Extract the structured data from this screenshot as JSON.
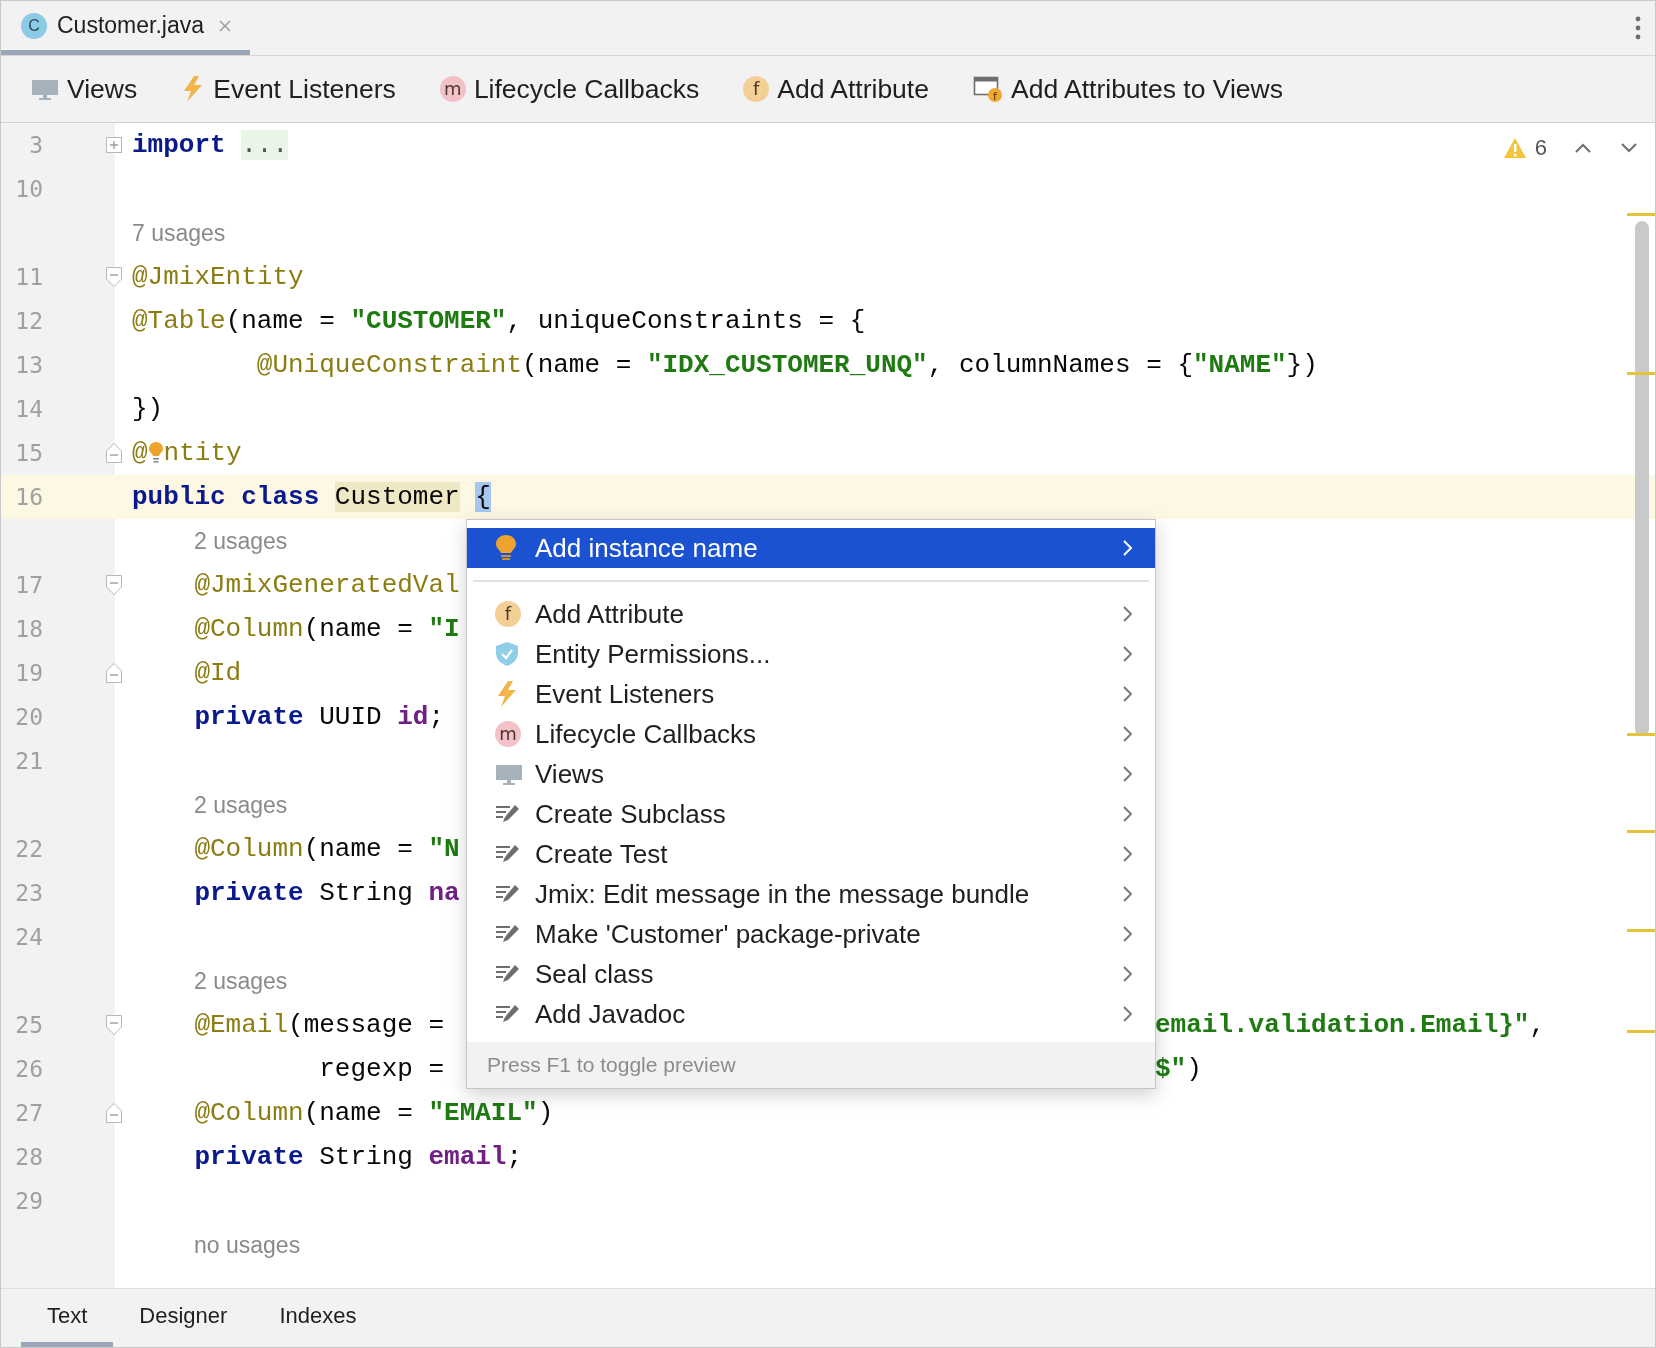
{
  "tabs": [
    {
      "label": "Customer.java",
      "badge": "C",
      "color": "#8ccbe6",
      "selected": true
    }
  ],
  "toolbar": {
    "items": [
      {
        "label": "Views",
        "kind": "monitor"
      },
      {
        "label": "Event Listeners",
        "kind": "bolt"
      },
      {
        "label": "Lifecycle Callbacks",
        "kind": "badge",
        "badge": "m",
        "color": "#f3c1c8"
      },
      {
        "label": "Add Attribute",
        "kind": "badge",
        "badge": "f",
        "color": "#f3cf96"
      },
      {
        "label": "Add Attributes to Views",
        "kind": "window",
        "badge": "f",
        "color": "#f0a732"
      }
    ]
  },
  "inspections": {
    "count": "6"
  },
  "editor": {
    "rows": [
      {
        "kind": "code",
        "number": "3",
        "collapsed": true,
        "current": false,
        "tokens": [
          {
            "kind": "kw",
            "text": "import"
          },
          {
            "kind": "folded",
            "text": "...",
            "space_before": true
          }
        ]
      },
      {
        "kind": "code",
        "number": "10",
        "current": false,
        "tokens": []
      },
      {
        "kind": "hint",
        "text": "7 usages"
      },
      {
        "kind": "code",
        "number": "11",
        "fold_start": true,
        "current": false,
        "tokens": [
          {
            "kind": "ann",
            "text": "@JmixEntity"
          }
        ]
      },
      {
        "kind": "code",
        "number": "12",
        "current": false,
        "tokens": [
          {
            "kind": "ann",
            "text": "@Table"
          },
          {
            "kind": "plain",
            "text": "(name ="
          },
          {
            "kind": "str",
            "text": "\"CUSTOMER\"",
            "space_before": true
          },
          {
            "kind": "plain",
            "text": ", uniqueConstraints = {"
          }
        ]
      },
      {
        "kind": "continuation",
        "number": "13",
        "current": false,
        "tokens": [
          {
            "kind": "ann",
            "text": "@UniqueConstraint"
          },
          {
            "kind": "plain",
            "text": "(name ="
          },
          {
            "kind": "str",
            "text": "\"IDX_CUSTOMER_UNQ\"",
            "space_before": true
          },
          {
            "kind": "plain",
            "text": ", columnNames = {"
          },
          {
            "kind": "str",
            "text": "\"NAME\""
          },
          {
            "kind": "plain",
            "text": "})"
          }
        ]
      },
      {
        "kind": "code",
        "number": "14",
        "current": false,
        "tokens": [
          {
            "kind": "plain",
            "text": "})"
          }
        ]
      },
      {
        "kind": "code",
        "number": "15",
        "fold_end": true,
        "current": false,
        "bulb": true,
        "tokens": [
          {
            "kind": "ann",
            "text": "@"
          },
          {
            "kind": "ann",
            "text": "ntity"
          }
        ]
      },
      {
        "kind": "code",
        "number": "16",
        "current": true,
        "tokens": [
          {
            "kind": "kw",
            "text": "public"
          },
          {
            "kind": "kw",
            "text": "class",
            "space_before": true
          },
          {
            "kind": "usage",
            "text": "Customer",
            "space_before": true
          },
          {
            "kind": "brace",
            "text": "{",
            "space_before": true
          }
        ]
      },
      {
        "kind": "member_hint",
        "text": "2 usages"
      },
      {
        "kind": "member",
        "number": "17",
        "fold_start": true,
        "current": false,
        "tokens": [
          {
            "kind": "ann",
            "text": "@JmixGeneratedVal"
          }
        ]
      },
      {
        "kind": "member",
        "number": "18",
        "current": false,
        "tokens": [
          {
            "kind": "ann",
            "text": "@Column"
          },
          {
            "kind": "plain",
            "text": "(name ="
          },
          {
            "kind": "str",
            "text": "\"I",
            "space_before": true
          }
        ]
      },
      {
        "kind": "member",
        "number": "19",
        "fold_end": true,
        "current": false,
        "tokens": [
          {
            "kind": "ann",
            "text": "@Id"
          }
        ]
      },
      {
        "kind": "member",
        "number": "20",
        "current": false,
        "tokens": [
          {
            "kind": "kw",
            "text": "private"
          },
          {
            "kind": "plain",
            "text": "UUID",
            "space_before": true
          },
          {
            "kind": "field",
            "text": "id",
            "space_before": true
          },
          {
            "kind": "plain",
            "text": ";"
          }
        ]
      },
      {
        "kind": "code",
        "number": "21",
        "current": false,
        "tokens": []
      },
      {
        "kind": "member_hint",
        "text": "2 usages"
      },
      {
        "kind": "member",
        "number": "22",
        "current": false,
        "tokens": [
          {
            "kind": "ann",
            "text": "@Column"
          },
          {
            "kind": "plain",
            "text": "(name ="
          },
          {
            "kind": "str",
            "text": "\"N",
            "space_before": true
          }
        ]
      },
      {
        "kind": "member",
        "number": "23",
        "current": false,
        "tokens": [
          {
            "kind": "kw",
            "text": "private"
          },
          {
            "kind": "plain",
            "text": "String",
            "space_before": true
          },
          {
            "kind": "field",
            "text": "na",
            "space_before": true
          }
        ]
      },
      {
        "kind": "code",
        "number": "24",
        "current": false,
        "tokens": []
      },
      {
        "kind": "member_hint",
        "text": "2 usages"
      },
      {
        "kind": "member",
        "number": "25",
        "fold_start": true,
        "current": false,
        "tokens": [
          {
            "kind": "ann",
            "text": "@Email"
          },
          {
            "kind": "plain",
            "text": "(message ="
          }
        ],
        "tail": [
          {
            "kind": "str",
            "text": "email.validation.Email}\""
          },
          {
            "kind": "plain",
            "text": ","
          }
        ]
      },
      {
        "kind": "argument",
        "number": "26",
        "current": false,
        "tokens": [
          {
            "kind": "plain",
            "text": "regexp ="
          }
        ],
        "tail": [
          {
            "kind": "str",
            "text": "$\""
          },
          {
            "kind": "plain",
            "text": ")"
          }
        ]
      },
      {
        "kind": "member",
        "number": "27",
        "fold_end": true,
        "current": false,
        "tokens": [
          {
            "kind": "ann",
            "text": "@Column"
          },
          {
            "kind": "plain",
            "text": "(name ="
          },
          {
            "kind": "str",
            "text": "\"EMAIL\"",
            "space_before": true
          },
          {
            "kind": "plain",
            "text": ")"
          }
        ]
      },
      {
        "kind": "member",
        "number": "28",
        "current": false,
        "tokens": [
          {
            "kind": "kw",
            "text": "private"
          },
          {
            "kind": "plain",
            "text": "String",
            "space_before": true
          },
          {
            "kind": "field",
            "text": "email",
            "space_before": true
          },
          {
            "kind": "plain",
            "text": ";"
          }
        ]
      },
      {
        "kind": "code",
        "number": "29",
        "current": false,
        "tokens": []
      },
      {
        "kind": "member_hint",
        "text": "no usages"
      }
    ]
  },
  "popup": {
    "groups": [
      {
        "items": [
          {
            "label": "Add instance name",
            "kind": "bulb",
            "selected": true
          }
        ]
      },
      {
        "items": [
          {
            "label": "Add Attribute",
            "kind": "badge",
            "badge": "f",
            "color": "#f3cf96",
            "selected": false
          },
          {
            "label": "Entity Permissions...",
            "kind": "shield",
            "selected": false
          },
          {
            "label": "Event Listeners",
            "kind": "bolt",
            "selected": false
          },
          {
            "label": "Lifecycle Callbacks",
            "kind": "badge",
            "badge": "m",
            "color": "#f3c1c8",
            "selected": false
          },
          {
            "label": "Views",
            "kind": "monitor",
            "selected": false
          },
          {
            "label": "Create Subclass",
            "kind": "edit",
            "selected": false
          },
          {
            "label": "Create Test",
            "kind": "edit",
            "selected": false
          },
          {
            "label": "Jmix: Edit message in the message bundle",
            "kind": "edit",
            "selected": false
          },
          {
            "label": "Make 'Customer' package-private",
            "kind": "edit",
            "selected": false
          },
          {
            "label": "Seal class",
            "kind": "edit",
            "selected": false
          },
          {
            "label": "Add Javadoc",
            "kind": "edit",
            "selected": false
          }
        ]
      }
    ],
    "footer": "Press F1 to toggle preview"
  },
  "bottom_tabs": [
    {
      "label": "Text",
      "selected": true
    },
    {
      "label": "Designer",
      "selected": false
    },
    {
      "label": "Indexes",
      "selected": false
    }
  ]
}
